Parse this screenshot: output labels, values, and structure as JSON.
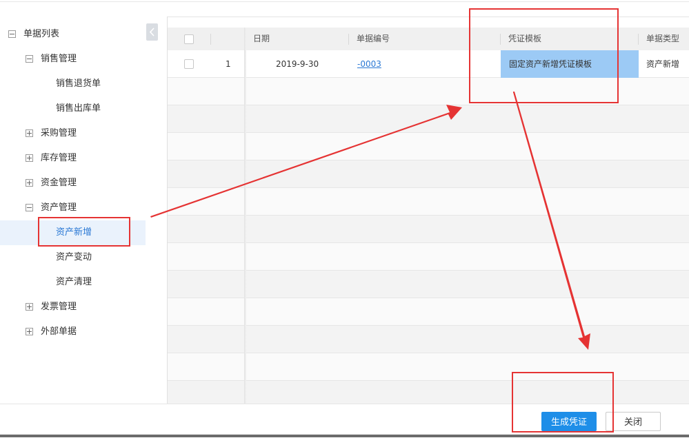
{
  "tree": {
    "root": "单据列表",
    "groups": {
      "sales": "销售管理",
      "sales_return": "销售退货单",
      "sales_outbound": "销售出库单",
      "purchase": "采购管理",
      "inventory": "库存管理",
      "funds": "资金管理",
      "assets": "资产管理",
      "asset_add": "资产新增",
      "asset_change": "资产变动",
      "asset_clear": "资产清理",
      "invoice": "发票管理",
      "external": "外部单据"
    }
  },
  "grid": {
    "columns": {
      "date": "日期",
      "doc_no": "单据编号",
      "voucher_template": "凭证模板",
      "doc_type": "单据类型"
    },
    "rows": [
      {
        "index": "1",
        "date": "2019-9-30",
        "doc_no": "-0003",
        "voucher_template": "固定资产新增凭证模板",
        "doc_type": "资产新增"
      }
    ]
  },
  "buttons": {
    "generate": "生成凭证",
    "close": "关闭"
  },
  "colors": {
    "annotation": "#e53333",
    "primary": "#1e8ee8",
    "selected_cell": "#9ccaf5",
    "active_text": "#2a78d4"
  }
}
